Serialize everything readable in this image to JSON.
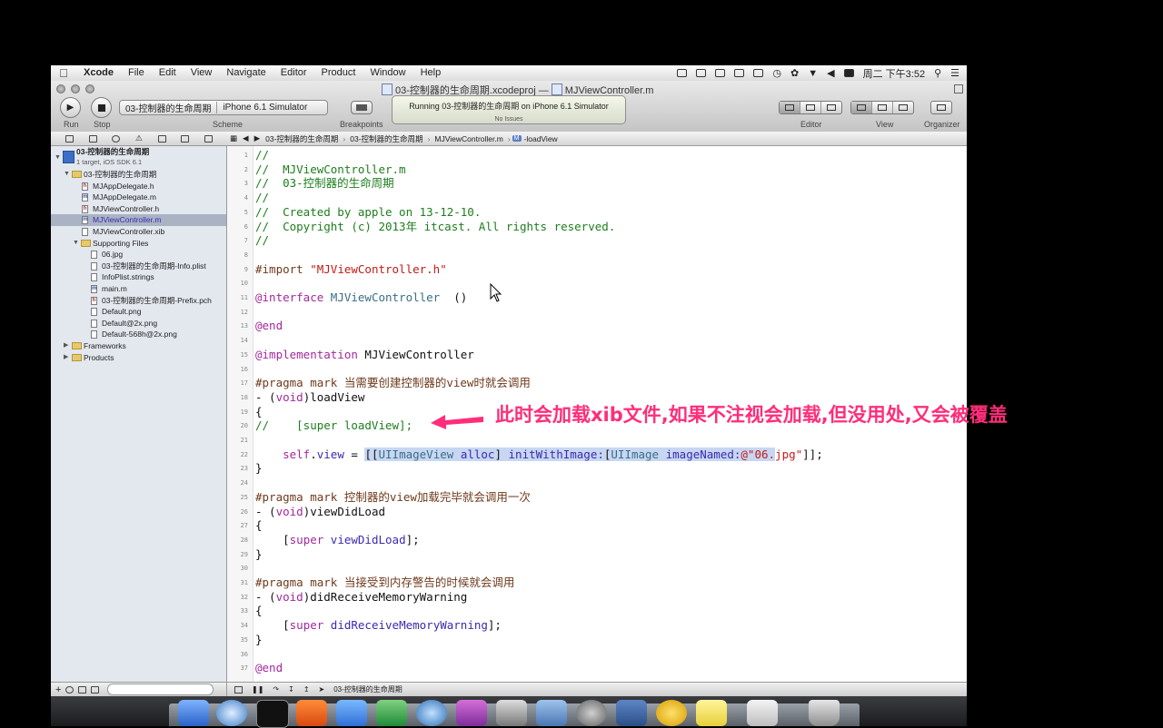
{
  "menubar": {
    "app_name": "Xcode",
    "menus": [
      "File",
      "Edit",
      "View",
      "Navigate",
      "Editor",
      "Product",
      "Window",
      "Help"
    ],
    "clock": "周二 下午3:52"
  },
  "window": {
    "title_project": "03-控制器的生命周期.xcodeproj",
    "title_separator": "—",
    "title_file": "MJViewController.m"
  },
  "toolbar": {
    "run_label": "Run",
    "stop_label": "Stop",
    "scheme_target": "03-控制器的生命周期",
    "scheme_device": "iPhone 6.1 Simulator",
    "scheme_label": "Scheme",
    "breakpoints_label": "Breakpoints",
    "activity_status": "Running 03-控制器的生命周期 on iPhone 6.1 Simulator",
    "activity_sub": "No Issues",
    "editor_label": "Editor",
    "view_label": "View",
    "organizer_label": "Organizer"
  },
  "navigator": {
    "project_name": "03-控制器的生命周期",
    "project_sub": "1 target, iOS SDK 6.1",
    "items": [
      {
        "label": "03-控制器的生命周期",
        "kind": "folder",
        "indent": 1,
        "open": true
      },
      {
        "label": "MJAppDelegate.h",
        "kind": "h",
        "indent": 2
      },
      {
        "label": "MJAppDelegate.m",
        "kind": "m",
        "indent": 2
      },
      {
        "label": "MJViewController.h",
        "kind": "h",
        "indent": 2
      },
      {
        "label": "MJViewController.m",
        "kind": "m",
        "indent": 2,
        "selected": true
      },
      {
        "label": "MJViewController.xib",
        "kind": "file",
        "indent": 2
      },
      {
        "label": "Supporting Files",
        "kind": "folder",
        "indent": 2,
        "open": true
      },
      {
        "label": "06.jpg",
        "kind": "file",
        "indent": 3
      },
      {
        "label": "03-控制器的生命周期-Info.plist",
        "kind": "file",
        "indent": 3
      },
      {
        "label": "InfoPlist.strings",
        "kind": "file",
        "indent": 3
      },
      {
        "label": "main.m",
        "kind": "m",
        "indent": 3
      },
      {
        "label": "03-控制器的生命周期-Prefix.pch",
        "kind": "h",
        "indent": 3
      },
      {
        "label": "Default.png",
        "kind": "file",
        "indent": 3
      },
      {
        "label": "Default@2x.png",
        "kind": "file",
        "indent": 3
      },
      {
        "label": "Default-568h@2x.png",
        "kind": "file",
        "indent": 3
      },
      {
        "label": "Frameworks",
        "kind": "folder",
        "indent": 1,
        "open": false
      },
      {
        "label": "Products",
        "kind": "folder",
        "indent": 1,
        "open": false
      }
    ]
  },
  "jumpbar": {
    "crumbs": [
      "03-控制器的生命周期",
      "03-控制器的生命周期",
      "MJViewController.m",
      "-loadView"
    ],
    "method_badge": "M"
  },
  "editor": {
    "lines": [
      {
        "n": "1",
        "segs": [
          [
            "cm",
            "//"
          ]
        ]
      },
      {
        "n": "2",
        "segs": [
          [
            "cm",
            "//  MJViewController.m"
          ]
        ]
      },
      {
        "n": "3",
        "segs": [
          [
            "cm",
            "//  03-控制器的生命周期"
          ]
        ]
      },
      {
        "n": "4",
        "segs": [
          [
            "cm",
            "//"
          ]
        ]
      },
      {
        "n": "5",
        "segs": [
          [
            "cm",
            "//  Created by apple on 13-12-10."
          ]
        ]
      },
      {
        "n": "6",
        "segs": [
          [
            "cm",
            "//  Copyright (c) 2013年 itcast. All rights reserved."
          ]
        ]
      },
      {
        "n": "7",
        "segs": [
          [
            "cm",
            "//"
          ]
        ]
      },
      {
        "n": "8",
        "segs": []
      },
      {
        "n": "9",
        "segs": [
          [
            "pp",
            "#import "
          ],
          [
            "st",
            "\"MJViewController.h\""
          ]
        ]
      },
      {
        "n": "10",
        "segs": []
      },
      {
        "n": "11",
        "segs": [
          [
            "kw",
            "@interface "
          ],
          [
            "cls",
            "MJViewController"
          ],
          [
            "",
            "  ()"
          ]
        ]
      },
      {
        "n": "12",
        "segs": []
      },
      {
        "n": "13",
        "segs": [
          [
            "kw",
            "@end"
          ]
        ]
      },
      {
        "n": "14",
        "segs": []
      },
      {
        "n": "15",
        "segs": [
          [
            "kw",
            "@implementation "
          ],
          [
            "",
            "MJViewController"
          ]
        ]
      },
      {
        "n": "16",
        "segs": []
      },
      {
        "n": "17",
        "segs": [
          [
            "pp",
            "#pragma mark 当需要创建控制器的view时就会调用"
          ]
        ]
      },
      {
        "n": "18",
        "segs": [
          [
            "",
            "- ("
          ],
          [
            "kw",
            "void"
          ],
          [
            "",
            ")loadView"
          ]
        ]
      },
      {
        "n": "19",
        "segs": [
          [
            "",
            "{"
          ]
        ]
      },
      {
        "n": "20",
        "segs": [
          [
            "cm",
            "//    [super loadView];"
          ]
        ]
      },
      {
        "n": "21",
        "segs": []
      },
      {
        "n": "22",
        "segs": [
          [
            "",
            "    "
          ],
          [
            "kw",
            "self"
          ],
          [
            "",
            "."
          ],
          [
            "sel",
            "view"
          ],
          [
            "",
            " = "
          ],
          [
            "hl",
            "[["
          ],
          [
            "hl cls",
            "UIImageView"
          ],
          [
            "hl",
            ""
          ],
          [
            "hl sel",
            " alloc"
          ],
          [
            "hl",
            "] "
          ],
          [
            "hl sel",
            "initWithImage:"
          ],
          [
            "hl",
            "["
          ],
          [
            "hl cls",
            "UIImage"
          ],
          [
            "hl sel",
            " imageNamed:"
          ],
          [
            "hl st",
            "@\"06."
          ],
          [
            "st",
            "jpg\""
          ],
          [
            "",
            "]];"
          ]
        ]
      },
      {
        "n": "23",
        "segs": [
          [
            "",
            "}"
          ]
        ]
      },
      {
        "n": "24",
        "segs": []
      },
      {
        "n": "25",
        "segs": [
          [
            "pp",
            "#pragma mark 控制器的view加载完毕就会调用一次"
          ]
        ]
      },
      {
        "n": "26",
        "segs": [
          [
            "",
            "- ("
          ],
          [
            "kw",
            "void"
          ],
          [
            "",
            ")viewDidLoad"
          ]
        ]
      },
      {
        "n": "27",
        "segs": [
          [
            "",
            "{"
          ]
        ]
      },
      {
        "n": "28",
        "segs": [
          [
            "",
            "    ["
          ],
          [
            "kw",
            "super"
          ],
          [
            "sel",
            " viewDidLoad"
          ],
          [
            "",
            "];"
          ]
        ]
      },
      {
        "n": "29",
        "segs": [
          [
            "",
            "}"
          ]
        ]
      },
      {
        "n": "30",
        "segs": []
      },
      {
        "n": "31",
        "segs": [
          [
            "pp",
            "#pragma mark 当接受到内存警告的时候就会调用"
          ]
        ]
      },
      {
        "n": "32",
        "segs": [
          [
            "",
            "- ("
          ],
          [
            "kw",
            "void"
          ],
          [
            "",
            ")didReceiveMemoryWarning"
          ]
        ]
      },
      {
        "n": "33",
        "segs": [
          [
            "",
            "{"
          ]
        ]
      },
      {
        "n": "34",
        "segs": [
          [
            "",
            "    ["
          ],
          [
            "kw",
            "super"
          ],
          [
            "sel",
            " didReceiveMemoryWarning"
          ],
          [
            "",
            "];"
          ]
        ]
      },
      {
        "n": "35",
        "segs": [
          [
            "",
            "}"
          ]
        ]
      },
      {
        "n": "36",
        "segs": []
      },
      {
        "n": "37",
        "segs": [
          [
            "kw",
            "@end"
          ]
        ]
      }
    ]
  },
  "annotation": {
    "text": "此时会加载xib文件,如果不注视会加载,但没用处,又会被覆盖",
    "color": "#ff2d7a"
  },
  "debugbar": {
    "target": "03-控制器的生命周期"
  },
  "colors": {
    "comment": "#1e7d1e",
    "keyword": "#a3289b",
    "string": "#c41a16",
    "preprocessor": "#6e3a1c",
    "class": "#3a6d87",
    "selection_row": "#a9b3c4"
  }
}
